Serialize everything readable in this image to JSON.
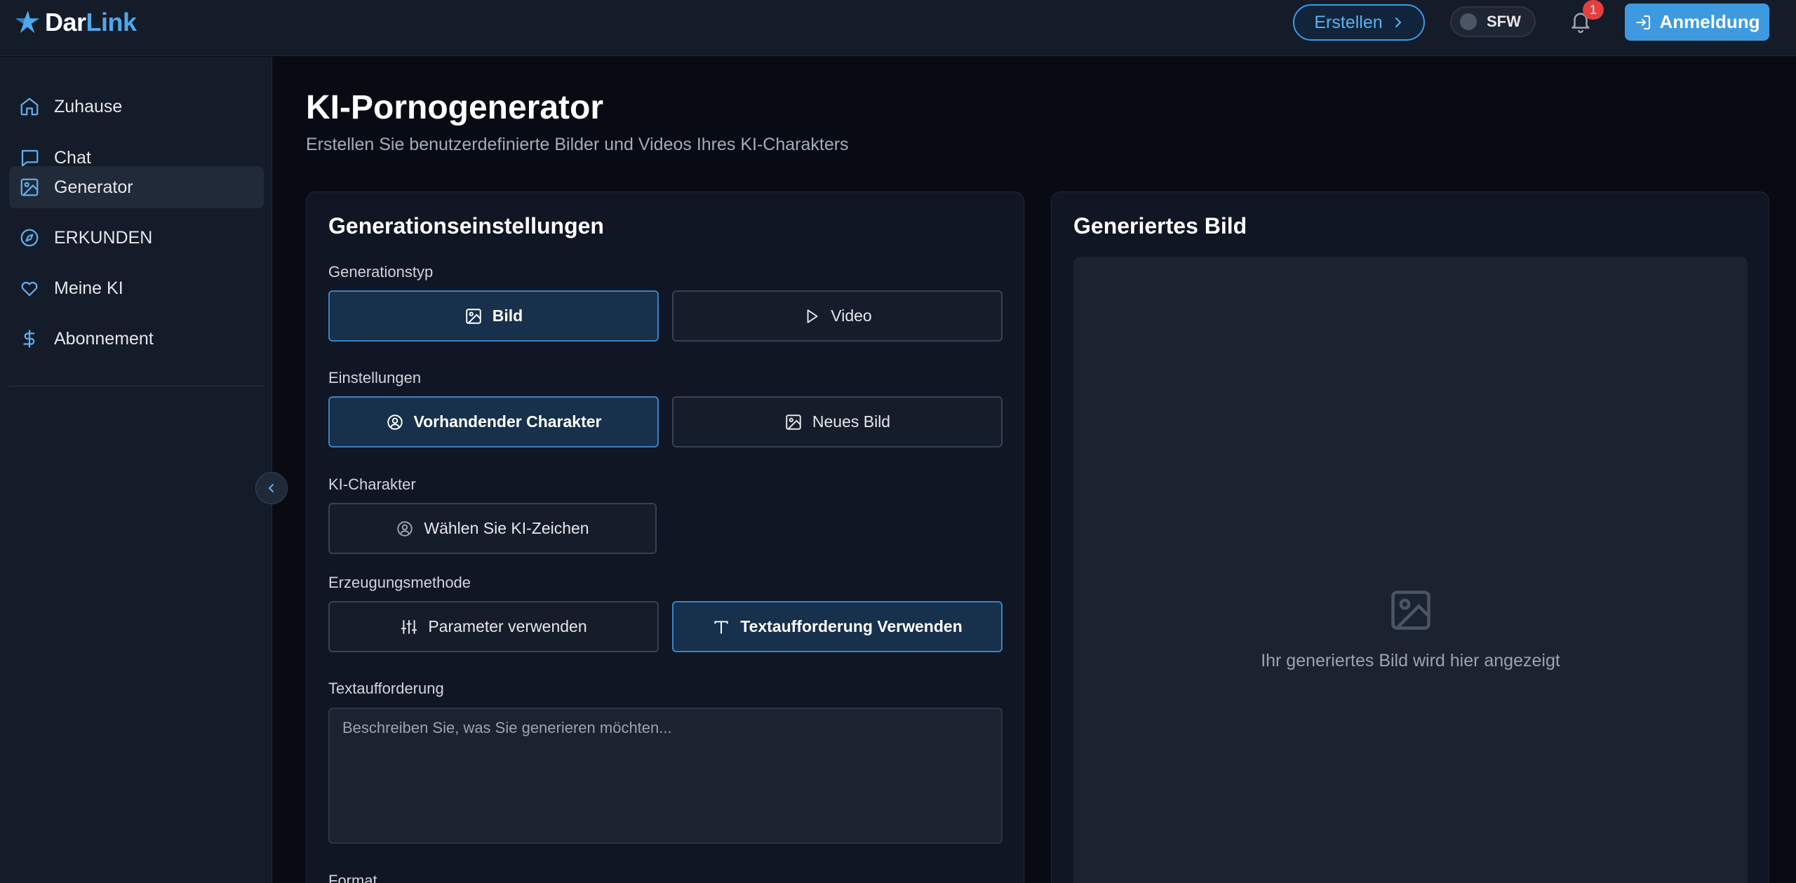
{
  "header": {
    "logo": {
      "part1": "Dar",
      "part2": "Link"
    },
    "create_label": "Erstellen",
    "sfw_label": "SFW",
    "notification_count": "1",
    "login_label": "Anmeldung"
  },
  "sidebar": {
    "items": [
      {
        "label": "Zuhause",
        "icon": "home-icon"
      },
      {
        "label": "Chat",
        "icon": "chat-icon"
      },
      {
        "label": "Generator",
        "icon": "image-icon",
        "active": true
      },
      {
        "label": "ERKUNDEN",
        "icon": "compass-icon"
      },
      {
        "label": "Meine KI",
        "icon": "heart-icon"
      },
      {
        "label": "Abonnement",
        "icon": "dollar-icon"
      }
    ]
  },
  "main": {
    "title": "KI-Pornogenerator",
    "subtitle": "Erstellen Sie benutzerdefinierte Bilder und Videos Ihres KI-Charakters"
  },
  "settings": {
    "title": "Generationseinstellungen",
    "generation_type": {
      "label": "Generationstyp",
      "options": [
        "Bild",
        "Video"
      ],
      "selected": "Bild"
    },
    "settings": {
      "label": "Einstellungen",
      "options": [
        "Vorhandender Charakter",
        "Neues Bild"
      ],
      "selected": "Vorhandender Charakter"
    },
    "character": {
      "label": "KI-Charakter",
      "button": "Wählen Sie KI-Zeichen"
    },
    "method": {
      "label": "Erzeugungsmethode",
      "options": [
        "Parameter verwenden",
        "Textaufforderung Verwenden"
      ],
      "selected": "Textaufforderung Verwenden"
    },
    "prompt": {
      "label": "Textaufforderung",
      "placeholder": "Beschreiben Sie, was Sie generieren möchten..."
    },
    "format": {
      "label": "Format"
    }
  },
  "result": {
    "title": "Generiertes Bild",
    "placeholder": "Ihr generiertes Bild wird hier angezeigt"
  },
  "colors": {
    "accent": "#3d9ae0",
    "background": "#080b14",
    "panel": "#101623",
    "badge": "#e53e3e"
  }
}
